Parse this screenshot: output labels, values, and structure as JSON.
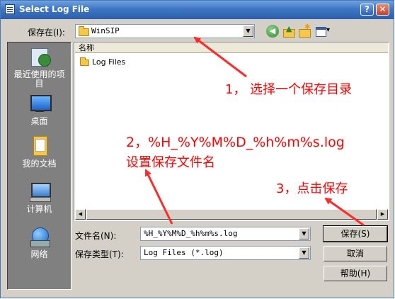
{
  "window": {
    "title": "Select Log File",
    "help_btn": "?",
    "close_btn": "✕"
  },
  "toolbar": {
    "lookin_label": "保存在(I):",
    "lookin_value": "WinSIP",
    "back_glyph": "◀"
  },
  "places": [
    {
      "label": "最近使用的项目",
      "icon": "recent-icon"
    },
    {
      "label": "桌面",
      "icon": "desktop-icon"
    },
    {
      "label": "我的文档",
      "icon": "documents-icon"
    },
    {
      "label": "计算机",
      "icon": "computer-icon"
    },
    {
      "label": "网络",
      "icon": "network-icon"
    }
  ],
  "filelist": {
    "column_header": "名称",
    "items": [
      {
        "name": "Log Files",
        "icon": "folder-icon"
      }
    ]
  },
  "form": {
    "filename_label": "文件名(N):",
    "filename_value": "%H_%Y%M%D_%h%m%s.log",
    "filetype_label": "保存类型(T):",
    "filetype_value": "Log Files (*.log)"
  },
  "buttons": {
    "save": "保存(S)",
    "cancel": "取消",
    "help": "帮助(H)"
  },
  "annotations": {
    "step1": "1，  选择一个保存目录",
    "step2_line1": "2，%H_%Y%M%D_%h%m%s.log",
    "step2_line2": "设置保存文件名",
    "step3": "3，点击保存"
  },
  "colors": {
    "annotation": "#ff0000",
    "titlebar": "#3f76c4",
    "places_bg": "#808080"
  }
}
